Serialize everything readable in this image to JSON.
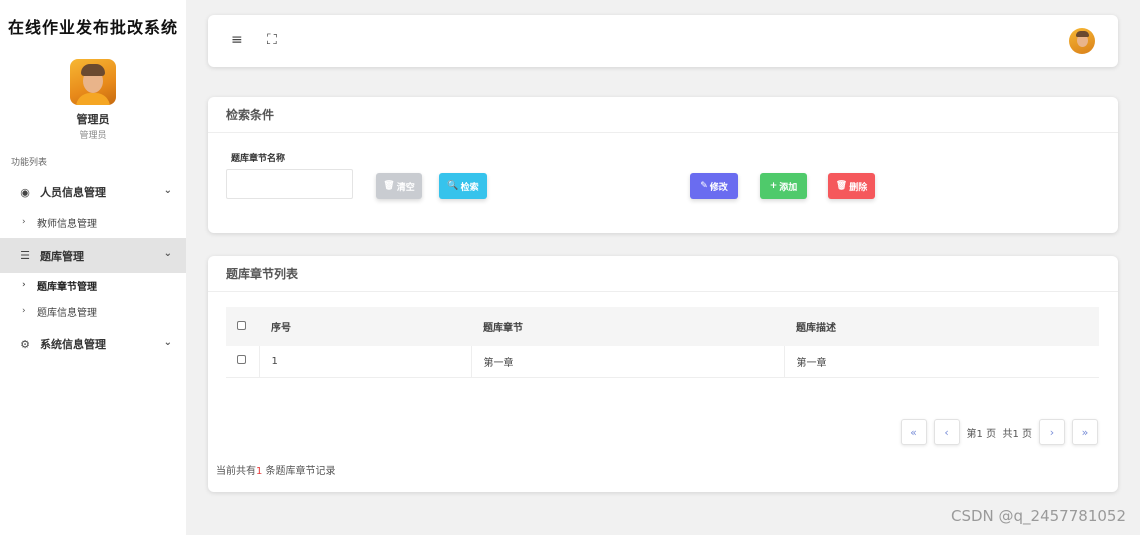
{
  "sidebar": {
    "app_title": "在线作业发布批改系统",
    "user": {
      "name": "管理员",
      "role": "管理员"
    },
    "menu_caption": "功能列表",
    "groups": [
      {
        "label": "人员信息管理",
        "icon": "user-circle-icon",
        "chevron": "⌄"
      },
      {
        "label": "题库管理",
        "icon": "list-icon",
        "chevron": "⌄",
        "active": true
      },
      {
        "label": "系统信息管理",
        "icon": "cogs-icon",
        "chevron": "⌄"
      }
    ],
    "subitems": [
      {
        "label": "教师信息管理"
      },
      {
        "label": "题库章节管理",
        "current": true
      },
      {
        "label": "题库信息管理"
      }
    ]
  },
  "topbar": {
    "menu_icon": "≡",
    "fullscreen_icon": "⛶"
  },
  "search_panel": {
    "title": "检索条件",
    "field_label": "题库章节名称",
    "field_value": "",
    "buttons": {
      "clear": "清空",
      "search": "检索",
      "edit": "修改",
      "add": "添加",
      "delete": "删除"
    }
  },
  "list_panel": {
    "title": "题库章节列表",
    "columns": [
      "序号",
      "题库章节",
      "题库描述"
    ],
    "rows": [
      {
        "index": "1",
        "chapter": "第一章",
        "description": "第一章"
      }
    ],
    "pager": {
      "first": "«",
      "prev": "‹",
      "page_prefix": "第",
      "page_current": "1",
      "page_suffix": "页",
      "total_prefix": "共",
      "total_pages": "1",
      "total_suffix": "页",
      "next": "›",
      "last": "»"
    },
    "record_prefix": "当前共有",
    "record_count": "1",
    "record_suffix": " 条题库章节记录"
  },
  "watermark": "CSDN @q_2457781052"
}
